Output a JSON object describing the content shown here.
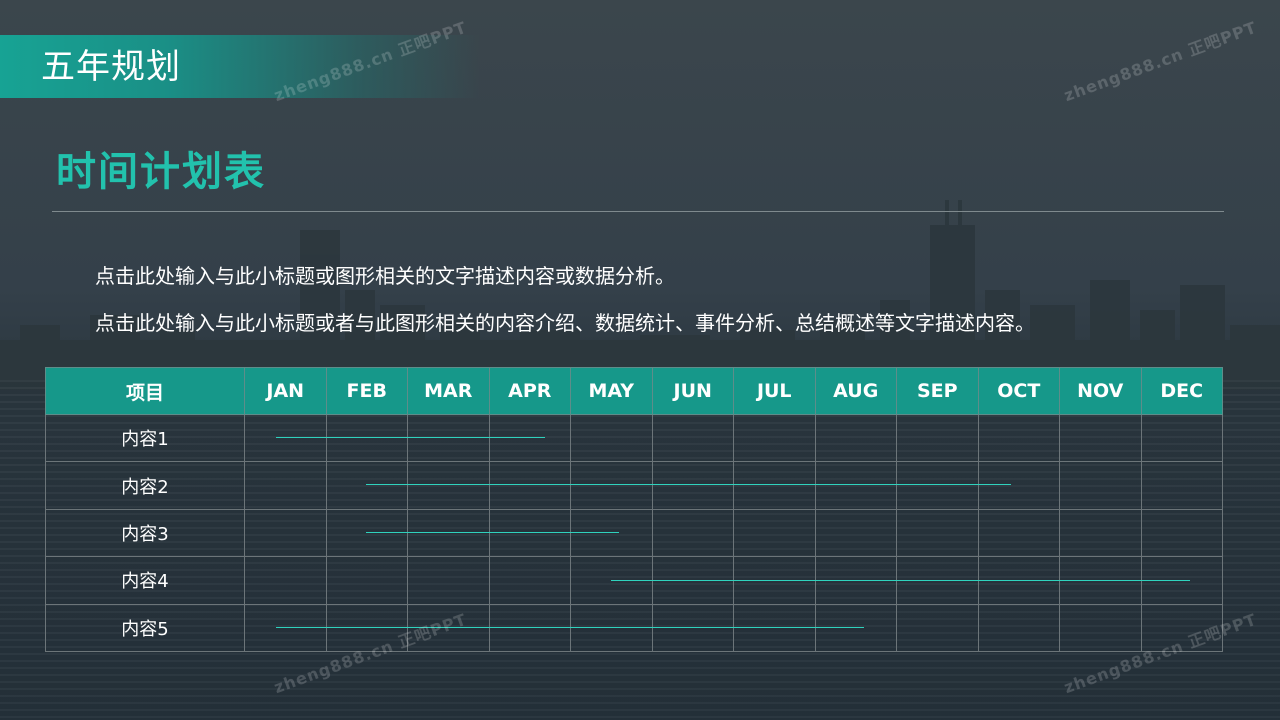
{
  "header": {
    "title": "五年规划"
  },
  "section": {
    "title": "时间计划表"
  },
  "description": {
    "line1": "点击此处输入与此小标题或图形相关的文字描述内容或数据分析。",
    "line2": "点击此处输入与此小标题或者与此图形相关的内容介绍、数据统计、事件分析、总结概述等文字描述内容。"
  },
  "table": {
    "columns": [
      "项目",
      "JAN",
      "FEB",
      "MAR",
      "APR",
      "MAY",
      "JUN",
      "JUL",
      "AUG",
      "SEP",
      "OCT",
      "NOV",
      "DEC"
    ],
    "rows": [
      {
        "label": "内容1",
        "start_month": 1.4,
        "end_month": 4.7
      },
      {
        "label": "内容2",
        "start_month": 2.5,
        "end_month": 10.4
      },
      {
        "label": "内容3",
        "start_month": 2.5,
        "end_month": 5.6
      },
      {
        "label": "内容4",
        "start_month": 5.5,
        "end_month": 12.6
      },
      {
        "label": "内容5",
        "start_month": 1.4,
        "end_month": 8.6
      }
    ]
  },
  "watermark": {
    "text": "zheng888.cn 正吧PPT"
  },
  "colors": {
    "accent": "#22c2ad",
    "header": "#16988a",
    "bar": "#2fd2bd"
  }
}
